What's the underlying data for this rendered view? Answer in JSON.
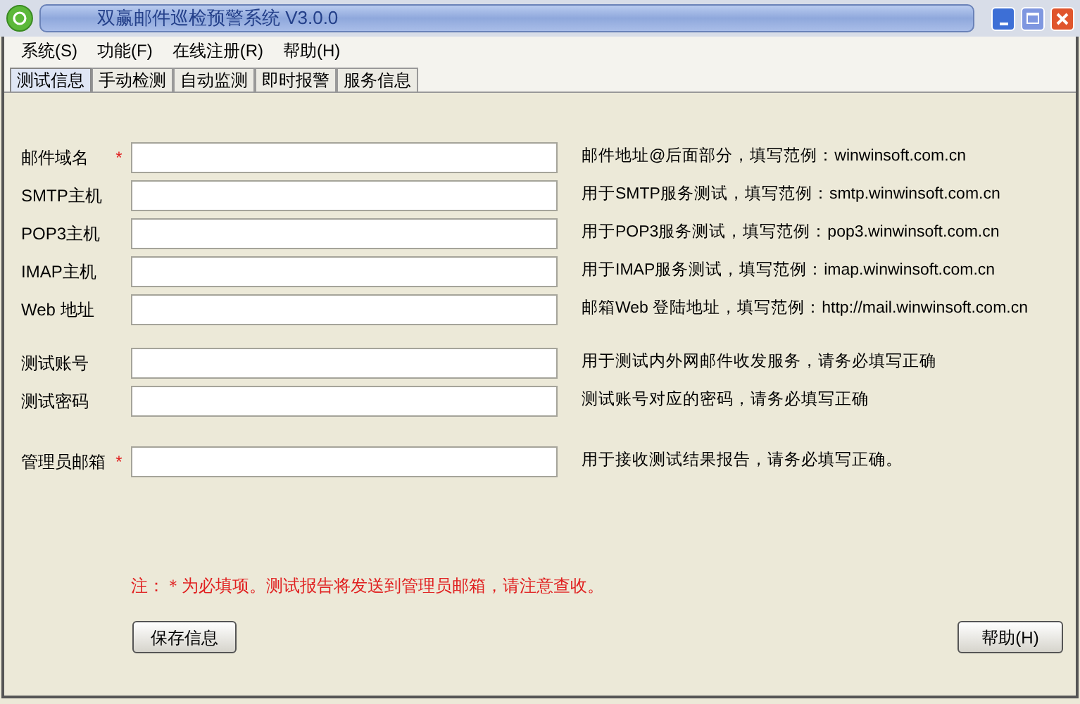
{
  "window": {
    "title": "双赢邮件巡检预警系统 V3.0.0"
  },
  "menu": [
    "系统(S)",
    "功能(F)",
    "在线注册(R)",
    "帮助(H)"
  ],
  "tabs": [
    {
      "label": "测试信息",
      "selected": true
    },
    {
      "label": "手动检测",
      "selected": false
    },
    {
      "label": "自动监测",
      "selected": false
    },
    {
      "label": "即时报警",
      "selected": false
    },
    {
      "label": "服务信息",
      "selected": false
    }
  ],
  "field_groups": [
    [
      {
        "label": "邮件域名",
        "required": true,
        "hint": "邮件地址@后面部分，填写范例：winwinsoft.com.cn"
      },
      {
        "label": "SMTP主机",
        "required": false,
        "hint": "用于SMTP服务测试，填写范例：smtp.winwinsoft.com.cn"
      },
      {
        "label": "POP3主机",
        "required": false,
        "hint": "用于POP3服务测试，填写范例：pop3.winwinsoft.com.cn"
      },
      {
        "label": "IMAP主机",
        "required": false,
        "hint": "用于IMAP服务测试，填写范例：imap.winwinsoft.com.cn"
      },
      {
        "label": "Web 地址",
        "required": false,
        "hint": "邮箱Web 登陆地址，填写范例：http://mail.winwinsoft.com.cn"
      }
    ],
    [
      {
        "label": "测试账号",
        "required": false,
        "hint": "用于测试内外网邮件收发服务，请务必填写正确"
      },
      {
        "label": "测试密码",
        "required": false,
        "hint": "测试账号对应的密码，请务必填写正确"
      }
    ],
    [
      {
        "label": "管理员邮箱",
        "required": true,
        "hint": "用于接收测试结果报告，请务必填写正确。"
      }
    ]
  ],
  "required_mark": "*",
  "note": "注：＊为必填项。测试报告将发送到管理员邮箱，请注意查收。",
  "buttons": {
    "save": "保存信息",
    "help": "帮助(H)"
  }
}
